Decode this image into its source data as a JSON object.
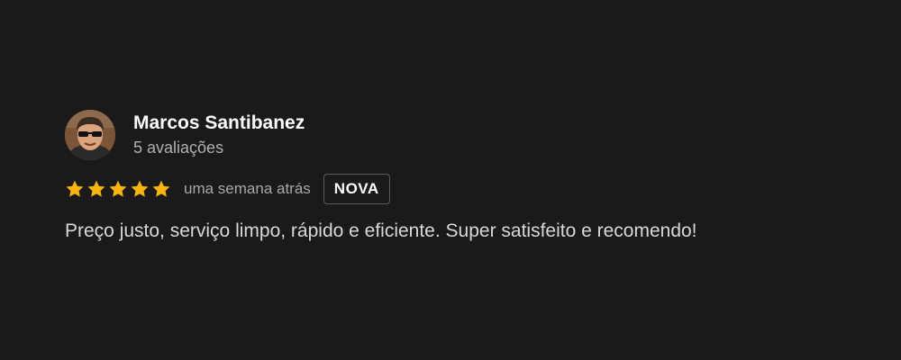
{
  "review": {
    "author": {
      "name": "Marcos Santibanez",
      "review_count": "5 avaliações",
      "avatar_icon": "user-avatar-photo"
    },
    "rating": {
      "value": 5,
      "max": 5,
      "star_color": "#f5b50a",
      "star_icon": "star-icon"
    },
    "time_ago": "uma semana atrás",
    "badge": "NOVA",
    "text": "Preço justo, serviço limpo, rápido e eficiente. Super satisfeito e recomendo!"
  },
  "theme": {
    "background": "#1a1a1a",
    "name_color": "#ffffff",
    "secondary_text": "#b0b0b0"
  }
}
